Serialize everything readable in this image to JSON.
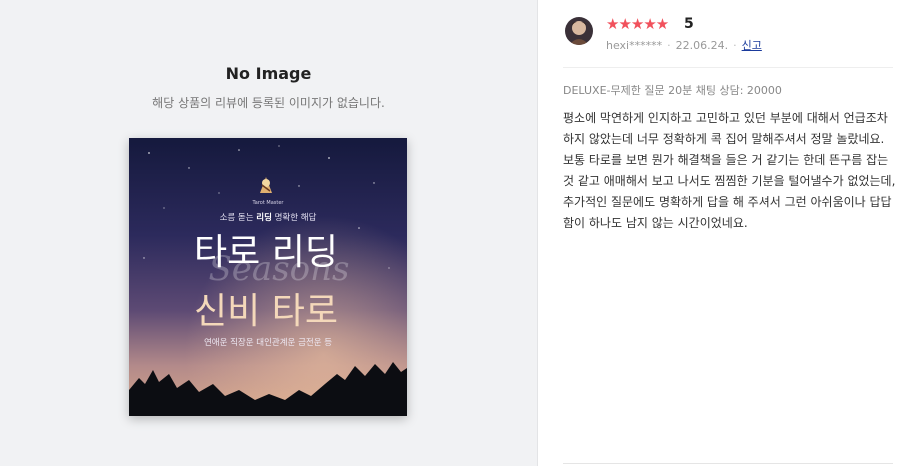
{
  "no_image": {
    "title": "No Image",
    "subtitle": "해당 상품의 리뷰에 등록된 이미지가 없습니다."
  },
  "product_banner": {
    "brand": "Tarot Master",
    "tagline_prefix": "소름 돋는 ",
    "tagline_bold": "리딩",
    "tagline_suffix": " 명확한 해답",
    "headline_1": "타로 리딩",
    "headline_2": "신비 타로",
    "watermark": "Seasons",
    "categories": "연애운 직장운 대인관계운 금전운 등"
  },
  "review": {
    "rating": 5,
    "stars": "★★★★★",
    "score_label": "5",
    "user": "hexi******",
    "date": "22.06.24.",
    "report_label": "신고",
    "option": "DELUXE-무제한 질문 20분 채팅 상담: 20000",
    "text": "평소에 막연하게 인지하고 고민하고 있던 부분에 대해서 언급조차 하지 않았는데 너무 정확하게 콕 집어 말해주셔서 정말 놀랐네요. 보통 타로를 보면 뭔가 해결책을 들은 거 같기는 한데 뜬구름 잡는 것 같고 애매해서 보고 나서도 찜찜한 기분을 털어낼수가 없었는데, 추가적인 질문에도 명확하게 답을 해 주셔서 그런 아쉬움이나 답답함이 하나도 남지 않는 시간이었네요."
  },
  "colors": {
    "star": "#f1515c",
    "report_link": "#1a3a9c",
    "left_panel_bg": "#f1f2f4"
  }
}
